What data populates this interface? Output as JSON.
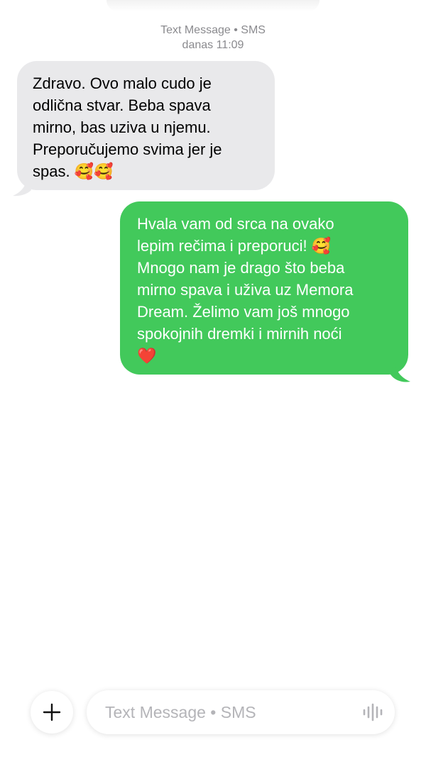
{
  "header": {
    "service": "Text Message • SMS",
    "timestamp": "danas 11:09"
  },
  "messages": [
    {
      "direction": "received",
      "text": "Zdravo. Ovo malo cudo je\nodlična stvar. Beba spava\nmirno, bas uziva u njemu.\nPreporučujemo svima jer je\nspas. 🥰🥰"
    },
    {
      "direction": "sent",
      "text": "Hvala vam od srca na ovako\nlepim rečima i preporuci! 🥰\nMnogo nam je drago što beba\nmirno spava i uživa uz Memora\nDream. Želimo vam još mnogo\nspokojnih dremki i mirnih noći\n❤️"
    }
  ],
  "composer": {
    "placeholder": "Text Message • SMS",
    "plus_icon": "plus-icon",
    "mic_icon": "waveform-icon"
  },
  "colors": {
    "sent_bubble": "#42c95b",
    "received_bubble": "#e9e9eb",
    "meta_text": "#8a8a8e"
  }
}
